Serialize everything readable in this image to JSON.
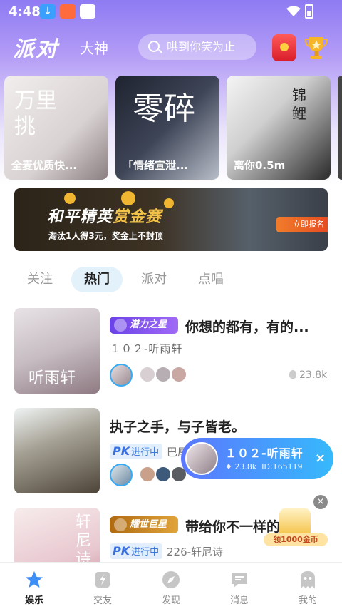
{
  "status_bar": {
    "time": "4:48"
  },
  "top_nav": {
    "tab_main": "派对",
    "tab_sub": "大神",
    "search_placeholder": "哄到你笑为止"
  },
  "featured_cards": [
    {
      "caption": "全麦优质快...",
      "art_text": "万里挑"
    },
    {
      "caption": "「情绪宣泄...",
      "art_text": "零碎"
    },
    {
      "caption": "离你0.5m",
      "art_text": "锦鲤"
    }
  ],
  "banner": {
    "title_a": "和平精英",
    "title_b": "赏金赛",
    "subtitle": "淘汰1人得3元，奖金上不封顶",
    "button": "立即报名"
  },
  "feed_tabs": [
    {
      "label": "关注",
      "active": false
    },
    {
      "label": "热门",
      "active": true
    },
    {
      "label": "派对",
      "active": false
    },
    {
      "label": "点唱",
      "active": false
    }
  ],
  "feed": [
    {
      "badge": "潜力之星",
      "title": "你想的都有，有的...",
      "host": "１０２-听雨轩",
      "heat": "23.8k",
      "thumb_text": "听雨轩"
    },
    {
      "pk_label": "PK",
      "pk_status": "进行中",
      "title": "执子之手，与子皆老。",
      "host": "巴厘"
    },
    {
      "badge": "耀世巨星",
      "title": "带给你不一样的",
      "pk_label": "PK",
      "pk_status": "进行中",
      "host": "226-轩尼诗",
      "thumb_text": "轩尼诗"
    }
  ],
  "floating_room": {
    "name": "１０２-听雨轩",
    "heat": "23.8k",
    "id_text": "ID:165119",
    "close": "×"
  },
  "coin_widget": {
    "close": "×",
    "label": "领1000金币"
  },
  "bottom_nav": [
    {
      "label": "娱乐",
      "icon": "star-icon",
      "active": true
    },
    {
      "label": "交友",
      "icon": "bolt-icon",
      "active": false
    },
    {
      "label": "发现",
      "icon": "compass-icon",
      "active": false
    },
    {
      "label": "消息",
      "icon": "message-icon",
      "active": false
    },
    {
      "label": "我的",
      "icon": "ghost-icon",
      "active": false
    }
  ],
  "colors": {
    "accent": "#36aaf5",
    "header_gradient_top": "#8e7bf3",
    "badge_purple": "#6b42e8",
    "badge_gold": "#b06a10"
  }
}
